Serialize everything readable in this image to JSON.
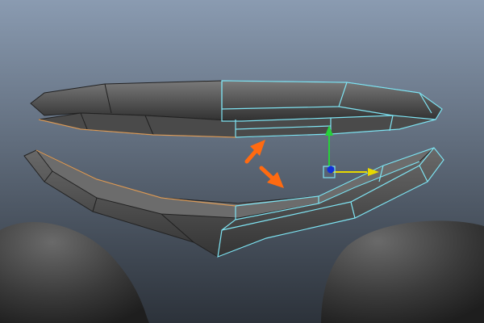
{
  "viewport": {
    "background_top": "#8a9bb1",
    "background_bottom": "#2c323a"
  },
  "colors": {
    "mesh_face": "#5c5c5c",
    "mesh_dark": "#2e2e2e",
    "wire_selected": "#7fe3f2",
    "wire_edge": "#d89a5a",
    "arrow": "#ff6a10",
    "manip_y": "#27d13a",
    "manip_x": "#e8d800",
    "manip_center": "#1030d8",
    "body": "#3a3a3a"
  },
  "annotations": {
    "arrows": [
      "orange-arrow-up-right",
      "orange-arrow-down-right"
    ]
  },
  "manipulator": {
    "type": "move-tool",
    "axes": [
      "y",
      "x"
    ]
  }
}
